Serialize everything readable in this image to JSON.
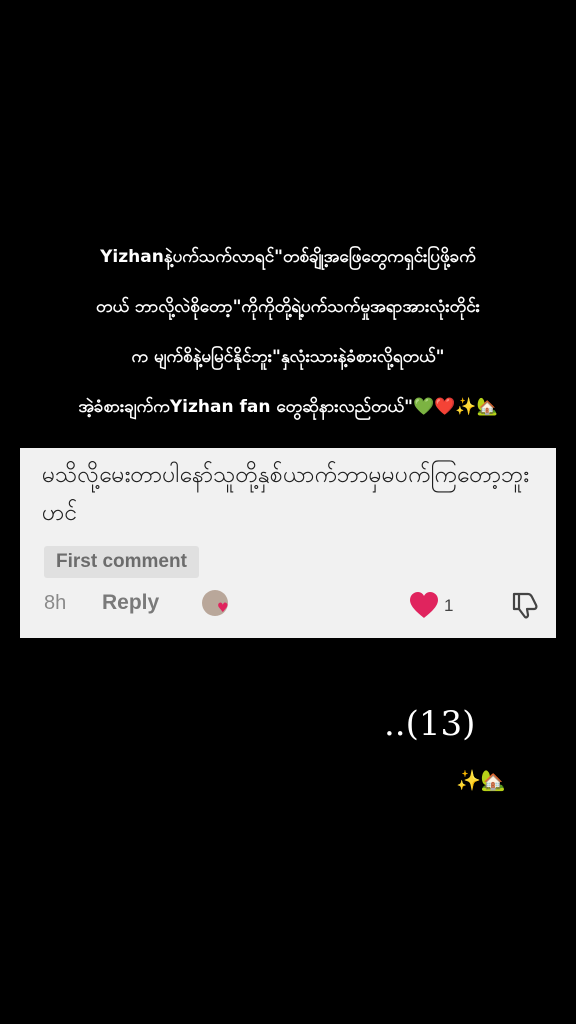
{
  "caption": {
    "lines": [
      "Yizhanနဲ့ပက်သက်လာရင်\"တစ်ချို့အဖြေတွေကရှင်းပြဖို့ခက်",
      "တယ် ဘာလို့လဲစိုတော့\"ကိုကိုတို့ရဲ့ပက်သက်မှုအရာအားလုံးတိုင်း",
      "က မျက်စိနဲ့မမြင်နိုင်ဘူး\"နှလုံးသားနဲ့ခံစားလို့ရတယ်\"",
      "အဲ့ခံစားချက်ကYizhan fan တွေဆိုနားလည်တယ်\"💚❤️✨🏡"
    ]
  },
  "comment": {
    "text": "မသိလို့မေးတာပါနော်သူတို့နှစ်ယာက်ဘာမှမပက်ကြတော့ဘူးဟင်",
    "badge": "First comment",
    "time": "8h",
    "reply_label": "Reply",
    "like_count": "1",
    "colors": {
      "card_bg": "#f1f1f1",
      "like": "#e0245e"
    }
  },
  "overlay": {
    "part_number": "..(13)",
    "emoji": "✨🏡"
  }
}
